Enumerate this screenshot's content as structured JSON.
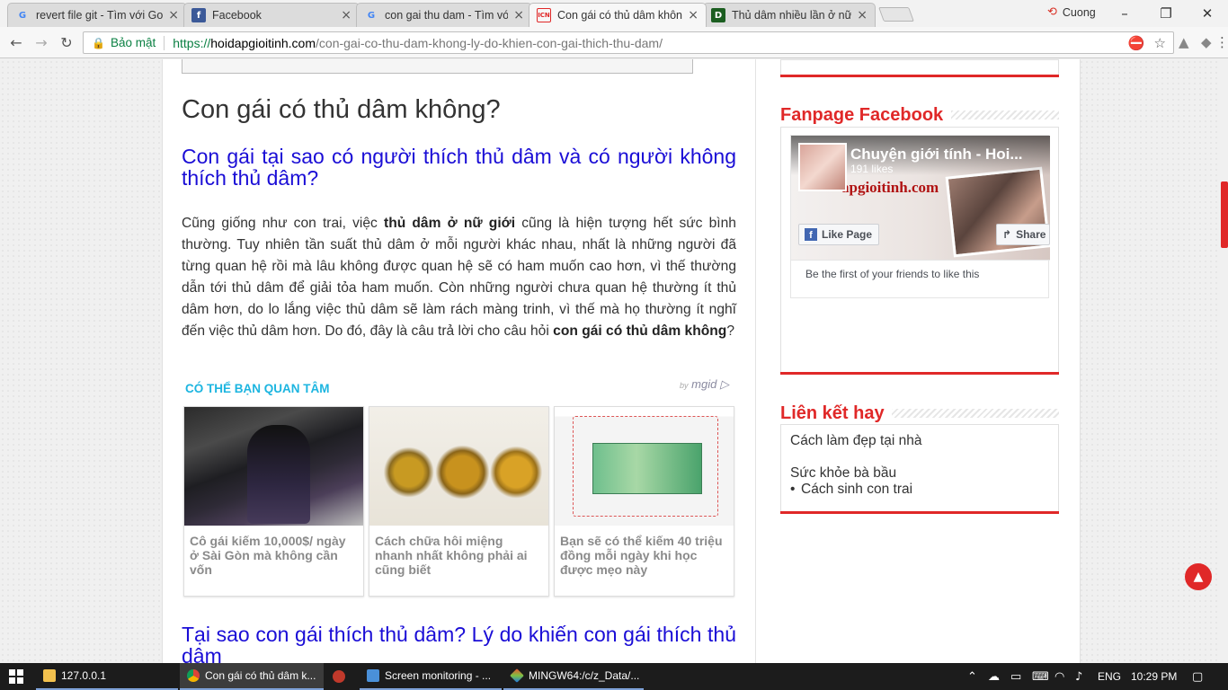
{
  "browser": {
    "tabs": [
      {
        "title": "revert file git - Tìm với Go",
        "favicon": "G",
        "favicon_color": "#4285f4",
        "favicon_bg": "#ffffff"
      },
      {
        "title": "Facebook",
        "favicon": "f",
        "favicon_color": "#ffffff",
        "favicon_bg": "#3b5998"
      },
      {
        "title": "con gai thu dam - Tìm vớ",
        "favicon": "G",
        "favicon_color": "#4285f4",
        "favicon_bg": "#ffffff"
      },
      {
        "title": "Con gái có thủ dâm khôn",
        "favicon": "ICN",
        "favicon_color": "#e02828",
        "favicon_bg": "#ffffff"
      },
      {
        "title": "Thủ dâm nhiều lần ở nữ g",
        "favicon": "D",
        "favicon_color": "#ffffff",
        "favicon_bg": "#1b5e20"
      }
    ],
    "profile_name": "Cuong",
    "security_label": "Bảo mật",
    "url_scheme": "https://",
    "url_host": "hoidapgioitinh.com",
    "url_path": "/con-gai-co-thu-dam-khong-ly-do-khien-con-gai-thich-thu-dam/"
  },
  "article": {
    "h2": "Con gái có thủ dâm không?",
    "h3_1": "Con gái tại sao có người thích thủ dâm và có người không thích thủ dâm?",
    "para_1": "Cũng giống như con trai, việc ",
    "para_bold_1": "thủ dâm ở nữ giới",
    "para_2": " cũng là hiện tượng hết sức bình thường. Tuy nhiên tần suất thủ dâm ở mỗi người khác nhau, nhất là những người đã từng quan hệ rồi mà lâu không được quan hệ sẽ có ham muốn cao hơn, vì thế thường dẫn tới thủ dâm để giải tỏa ham muốn. Còn những người chưa quan hệ thường ít thủ dâm hơn, do lo lắng việc thủ dâm sẽ làm rách màng trinh, vì thế mà họ thường ít nghĩ đến việc thủ dâm hơn. Do đó, đây là câu trả lời cho câu hỏi ",
    "para_bold_2": "con gái có thủ dâm không",
    "para_3": "?",
    "h3_2": "Tại sao con gái thích thủ dâm? Lý do khiến con gái thích thủ dâm"
  },
  "widget": {
    "title": "CÓ THỂ BẠN QUAN TÂM",
    "by": "by",
    "brand": "mgid",
    "cards": [
      {
        "caption": "Cô gái kiếm 10,000$/ ngày ở Sài Gòn mà không cần vốn"
      },
      {
        "caption": "Cách chữa hôi miệng nhanh nhất không phải ai cũng biết"
      },
      {
        "caption": "Bạn sẽ có thể kiếm 40 triệu đồng mỗi ngày khi học được mẹo này"
      }
    ]
  },
  "sidebar": {
    "fanpage_title": "Fanpage Facebook",
    "fb_page_name": "Chuyện giới tính - Hoi...",
    "fb_likes": "191 likes",
    "fb_cover_brand": "apgioitinh.com",
    "fb_like_label": "Like Page",
    "fb_share_label": "Share",
    "fb_friends": "Be the first of your friends to like this",
    "links_title": "Liên kết hay",
    "links": [
      "Cách làm đẹp tại nhà",
      "Sức khỏe bà bầu",
      "Cách sinh con trai"
    ]
  },
  "taskbar": {
    "items": [
      "127.0.0.1",
      "Con gái có thủ dâm k...",
      "Screen monitoring - ...",
      "MINGW64:/c/z_Data/..."
    ],
    "language": "ENG",
    "time": "10:29 PM"
  },
  "colors": {
    "accent": "#e02828",
    "link": "#1a0dd6",
    "widget_title": "#1cb5e0"
  }
}
